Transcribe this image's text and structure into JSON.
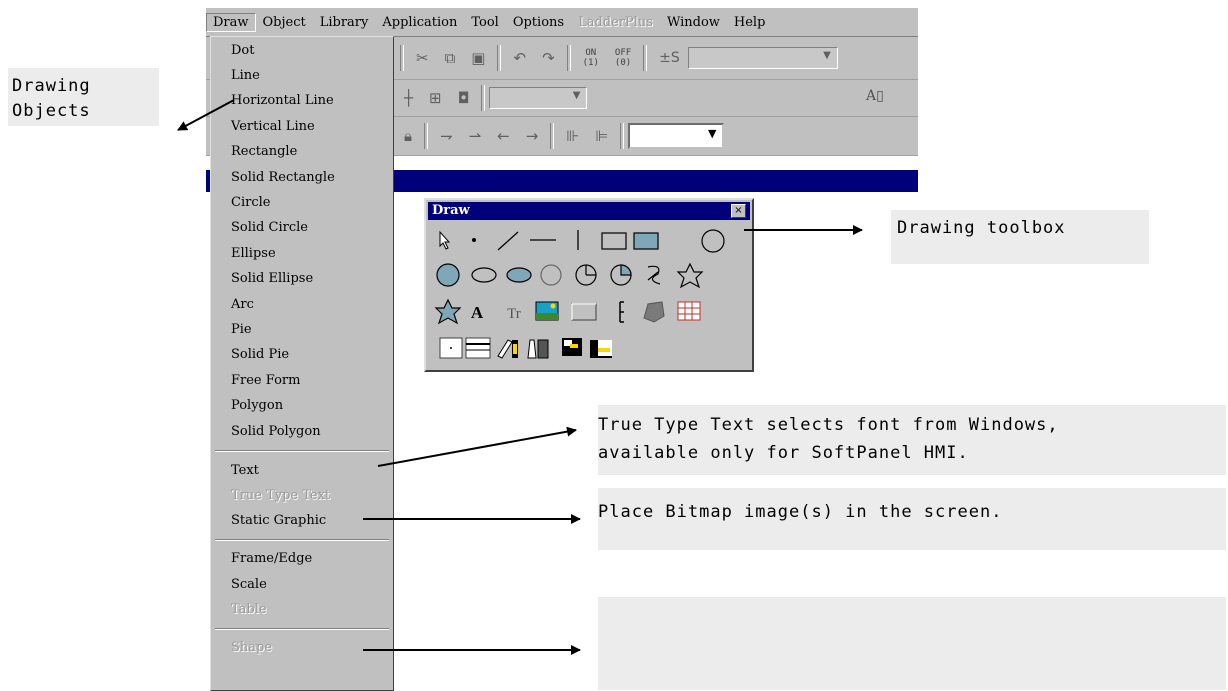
{
  "menubar": {
    "items": [
      "Draw",
      "Object",
      "Library",
      "Application",
      "Tool",
      "Options",
      "LadderPlus",
      "Window",
      "Help"
    ]
  },
  "toolbar": {
    "on_label_top": "ON",
    "on_label_bottom": "(1)",
    "off_label_top": "OFF",
    "off_label_bottom": "(0)",
    "pm_label": "±S",
    "font_button": "A"
  },
  "draw_menu": {
    "group1": [
      "Dot",
      "Line",
      "Horizontal Line",
      "Vertical Line",
      "Rectangle",
      "Solid Rectangle",
      "Circle",
      "Solid Circle",
      "Ellipse",
      "Solid Ellipse",
      "Arc",
      "Pie",
      "Solid Pie",
      "Free Form",
      "Polygon",
      "Solid Polygon"
    ],
    "group2": [
      "Text",
      "True Type Text",
      "Static Graphic"
    ],
    "group3": [
      "Frame/Edge",
      "Scale",
      "Table"
    ],
    "group4": [
      "Shape"
    ],
    "disabled": [
      "True Type Text",
      "Table",
      "Shape"
    ]
  },
  "toolbox": {
    "title": "Draw",
    "close": "×",
    "text_tool": "A",
    "truetype_tool": "Tr"
  },
  "annotations": {
    "drawing_objects": [
      "Drawing",
      "Objects"
    ],
    "drawing_toolbox": "Drawing toolbox",
    "true_type": [
      "True Type Text selects font from Windows,",
      "available only for SoftPanel HMI."
    ],
    "static_graphic": "Place Bitmap image(s) in the screen.",
    "shape": ""
  },
  "colors": {
    "menu_bg": "#c0c0c0",
    "title_bar": "#00007b",
    "callout_bg": "#ececec"
  }
}
